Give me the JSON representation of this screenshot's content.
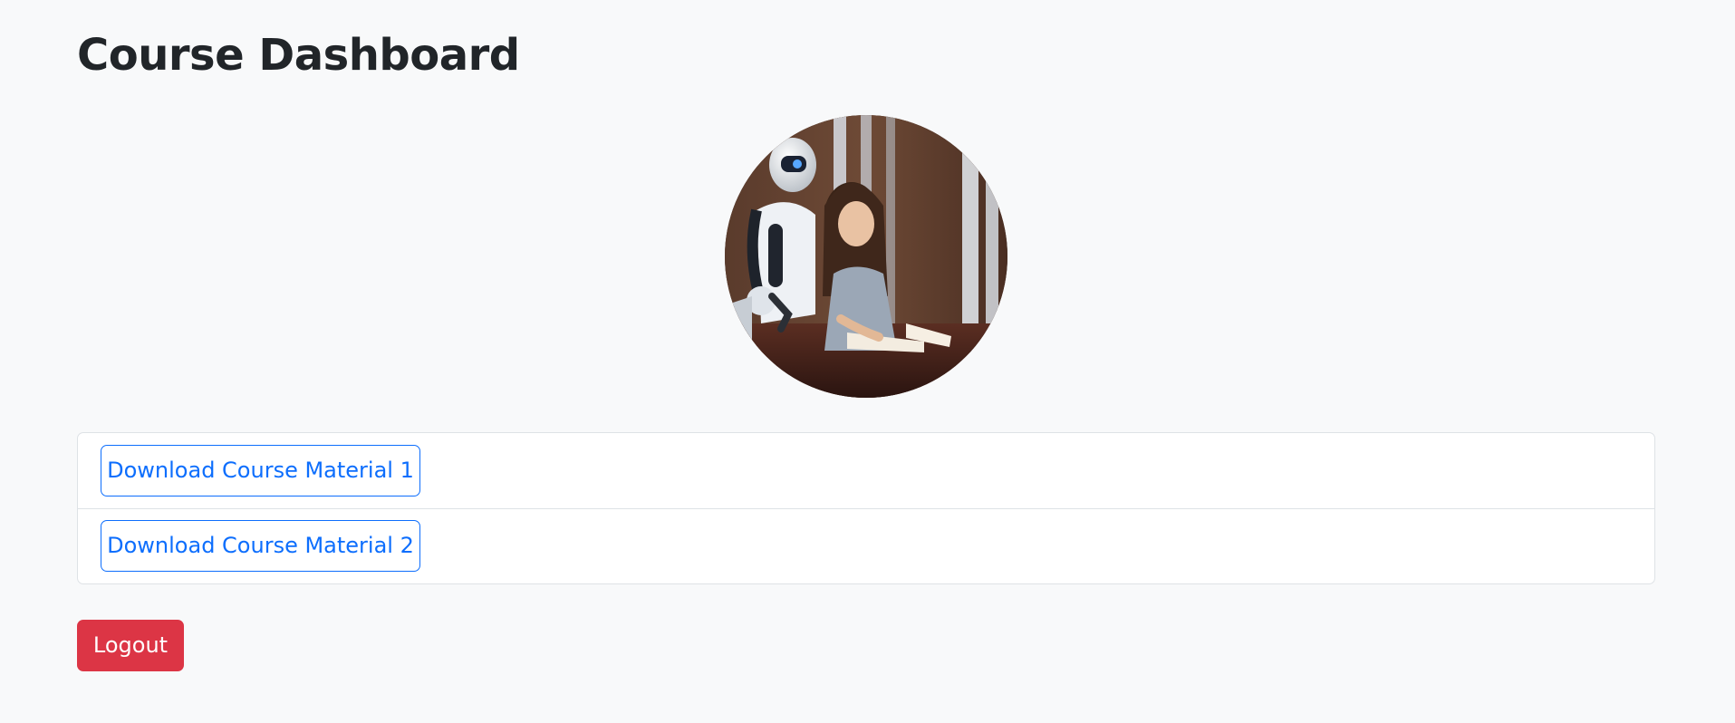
{
  "header": {
    "title": "Course Dashboard"
  },
  "hero_image": {
    "subject": "robot and girl reading a book",
    "shape": "circle"
  },
  "materials": {
    "items": [
      {
        "label": "Download Course Material 1"
      },
      {
        "label": "Download Course Material 2"
      }
    ]
  },
  "actions": {
    "logout_label": "Logout"
  },
  "colors": {
    "background": "#f8f9fa",
    "primary": "#0d6efd",
    "danger": "#dc3545",
    "border": "#dee2e6"
  }
}
